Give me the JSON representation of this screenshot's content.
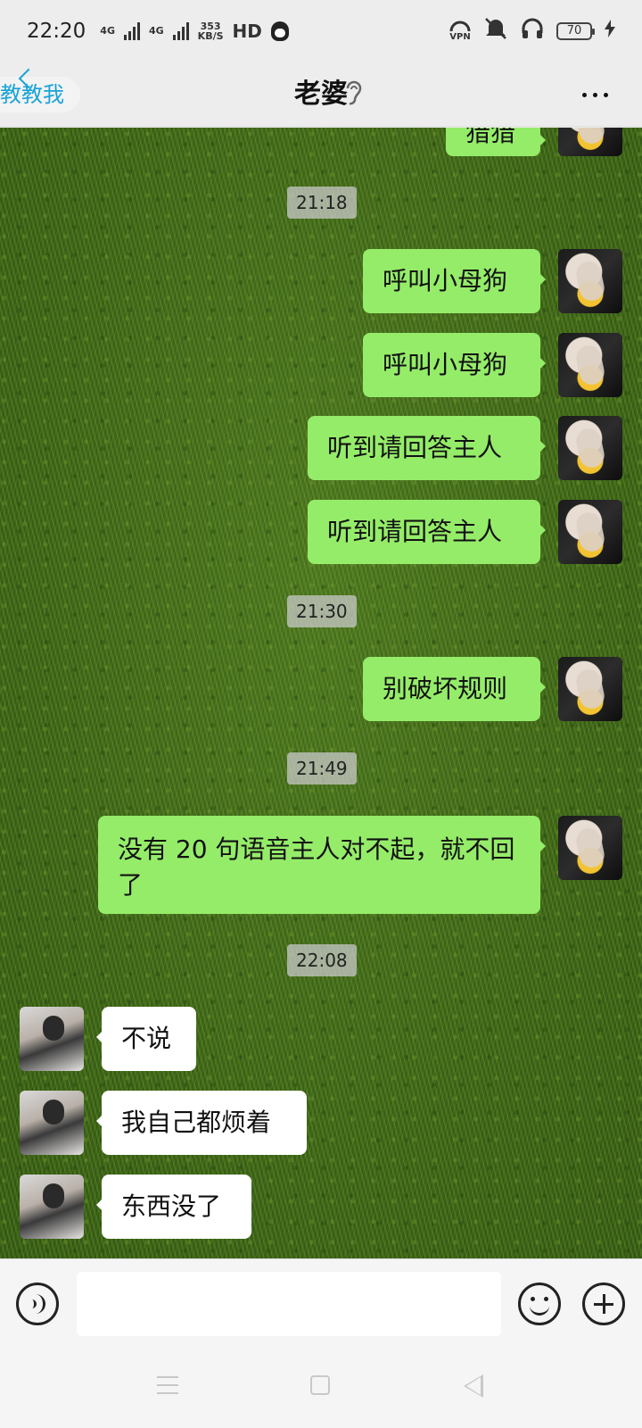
{
  "status_bar": {
    "time": "22:20",
    "signal1_label": "4G",
    "signal2_label": "4G",
    "speed_value": "353",
    "speed_unit": "KB/S",
    "hd_label": "HD",
    "vpn_label": "VPN",
    "battery": "70"
  },
  "header": {
    "back_label": "教教我",
    "title": "老婆"
  },
  "timestamps": [
    "21:18",
    "21:30",
    "21:49",
    "22:08"
  ],
  "messages": {
    "partial_top": "猎猎",
    "m1": "呼叫小母狗",
    "m2": "呼叫小母狗",
    "m3": "听到请回答主人",
    "m4": "听到请回答主人",
    "m5": "别破坏规则",
    "m6": "没有 20 句语音主人对不起，就不回了",
    "r1": "不说",
    "r2": "我自己都烦着",
    "r3": "东西没了"
  },
  "input": {
    "value": "",
    "placeholder": ""
  },
  "colors": {
    "outgoing_bubble": "#95ec69",
    "incoming_bubble": "#ffffff",
    "back_text": "#1aa3d8"
  }
}
